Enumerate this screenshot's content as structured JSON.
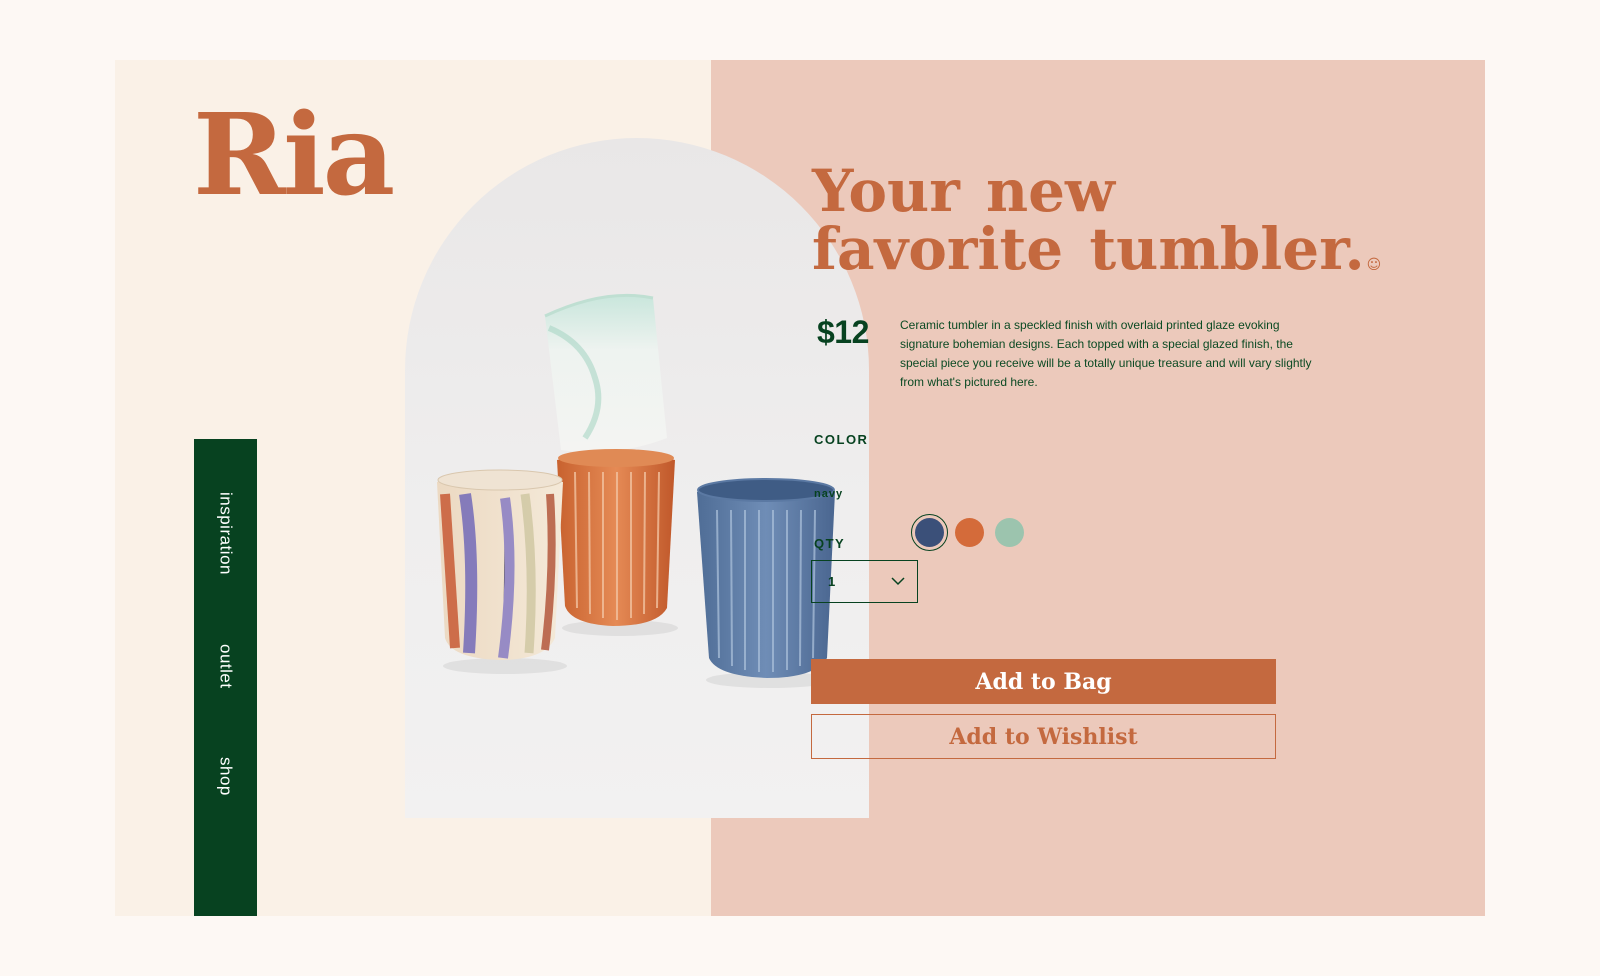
{
  "brand": {
    "logo_text": "Ria"
  },
  "nav": {
    "items": [
      {
        "label": "inspiration"
      },
      {
        "label": "outlet"
      },
      {
        "label": "shop"
      }
    ]
  },
  "product": {
    "headline_line1": "Your new",
    "headline_line2": "favorite tumbler",
    "headline_punct": ".",
    "headline_icon": "smile-icon",
    "price": "$12",
    "description": "Ceramic tumbler in a speckled finish with overlaid printed glaze evoking signature bohemian designs. Each topped with a special glazed finish, the special piece you receive will be a totally unique treasure and will vary slightly from what's pictured here.",
    "image_alt": "Four ceramic tumblers: painted cream, teal-white, orange ribbed and blue ribbed"
  },
  "color": {
    "label": "COLOR",
    "selected_name": "navy",
    "swatches": [
      {
        "name": "navy",
        "hex": "#3b5079"
      },
      {
        "name": "orange",
        "hex": "#d46b3a"
      },
      {
        "name": "sage",
        "hex": "#9cc4ae"
      }
    ]
  },
  "qty": {
    "label": "QTY",
    "value": "1",
    "icon": "chevron-down-icon"
  },
  "actions": {
    "add_to_bag": "Add to Bag",
    "add_to_wishlist": "Add to Wishlist"
  },
  "colors": {
    "accent": "#c4693f",
    "dark_green": "#074220",
    "panel_pink": "#ecc9bb",
    "panel_cream": "#faf1e7"
  }
}
